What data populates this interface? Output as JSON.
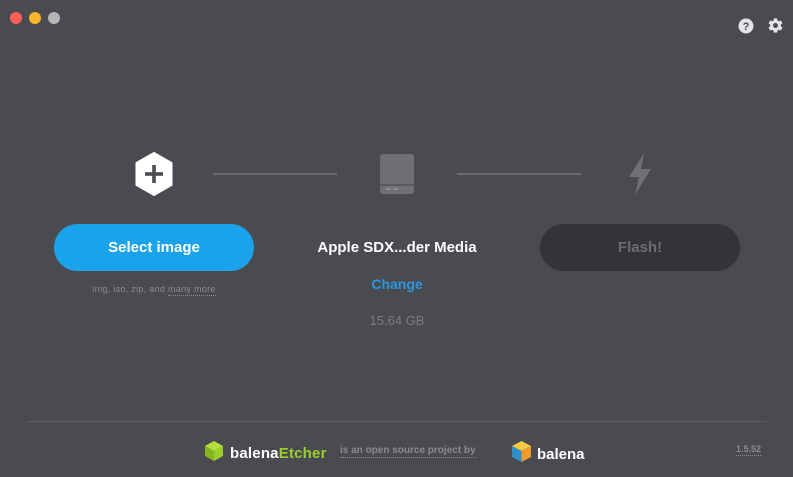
{
  "window": {
    "controls": [
      "close",
      "minimize",
      "zoom"
    ]
  },
  "toolbar": {
    "help_icon": "help-circle-icon",
    "settings_icon": "gear-icon"
  },
  "steps": {
    "image": {
      "icon": "plus-hexagon-icon",
      "button_label": "Select image",
      "hint_formats": "img, iso, zip, and",
      "hint_more": "many more"
    },
    "drive": {
      "icon": "drive-icon",
      "name": "Apple SDX...der Media",
      "change_label": "Change",
      "size": "15.64 GB"
    },
    "flash": {
      "icon": "lightning-icon",
      "button_label": "Flash!"
    }
  },
  "footer": {
    "etcher_brand_prefix": "balena",
    "etcher_brand_suffix": "Etcher",
    "tagline": "is an open source project by",
    "balena_brand": "balena",
    "version": "1.5.52"
  },
  "colors": {
    "background": "#4a4b51",
    "accent_blue": "#1aa3eb",
    "link_blue": "#2a97e0",
    "etcher_green": "#9acf2a",
    "disabled_button": "#333438"
  }
}
